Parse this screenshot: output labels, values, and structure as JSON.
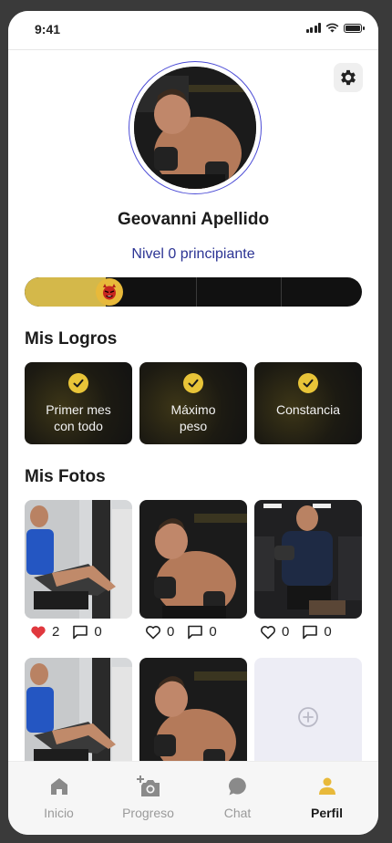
{
  "status_bar": {
    "time": "9:41"
  },
  "profile": {
    "name": "Geovanni Apellido",
    "level": "Nivel 0 principiante",
    "progress_fraction": 0.24
  },
  "colors": {
    "accent": "#d4b84a",
    "level_text": "#2c3494",
    "ring": "#4c4cd6",
    "heart": "#e0383e"
  },
  "achievements": {
    "title": "Mis Logros",
    "items": [
      {
        "line1": "Primer mes",
        "line2": "con todo"
      },
      {
        "line1": "Máximo",
        "line2": "peso"
      },
      {
        "line1": "Constancia",
        "line2": ""
      }
    ]
  },
  "photos": {
    "title": "Mis Fotos",
    "items": [
      {
        "likes": "2",
        "comments": "0",
        "liked": true
      },
      {
        "likes": "0",
        "comments": "0",
        "liked": false
      },
      {
        "likes": "0",
        "comments": "0",
        "liked": false
      }
    ],
    "add_icon": "plus-circle-icon"
  },
  "tabbar": {
    "tabs": [
      {
        "label": "Inicio",
        "icon": "home-icon"
      },
      {
        "label": "Progreso",
        "icon": "add-photo-icon"
      },
      {
        "label": "Chat",
        "icon": "chat-bubble-icon"
      },
      {
        "label": "Perfil",
        "icon": "person-icon",
        "active": true
      }
    ]
  }
}
